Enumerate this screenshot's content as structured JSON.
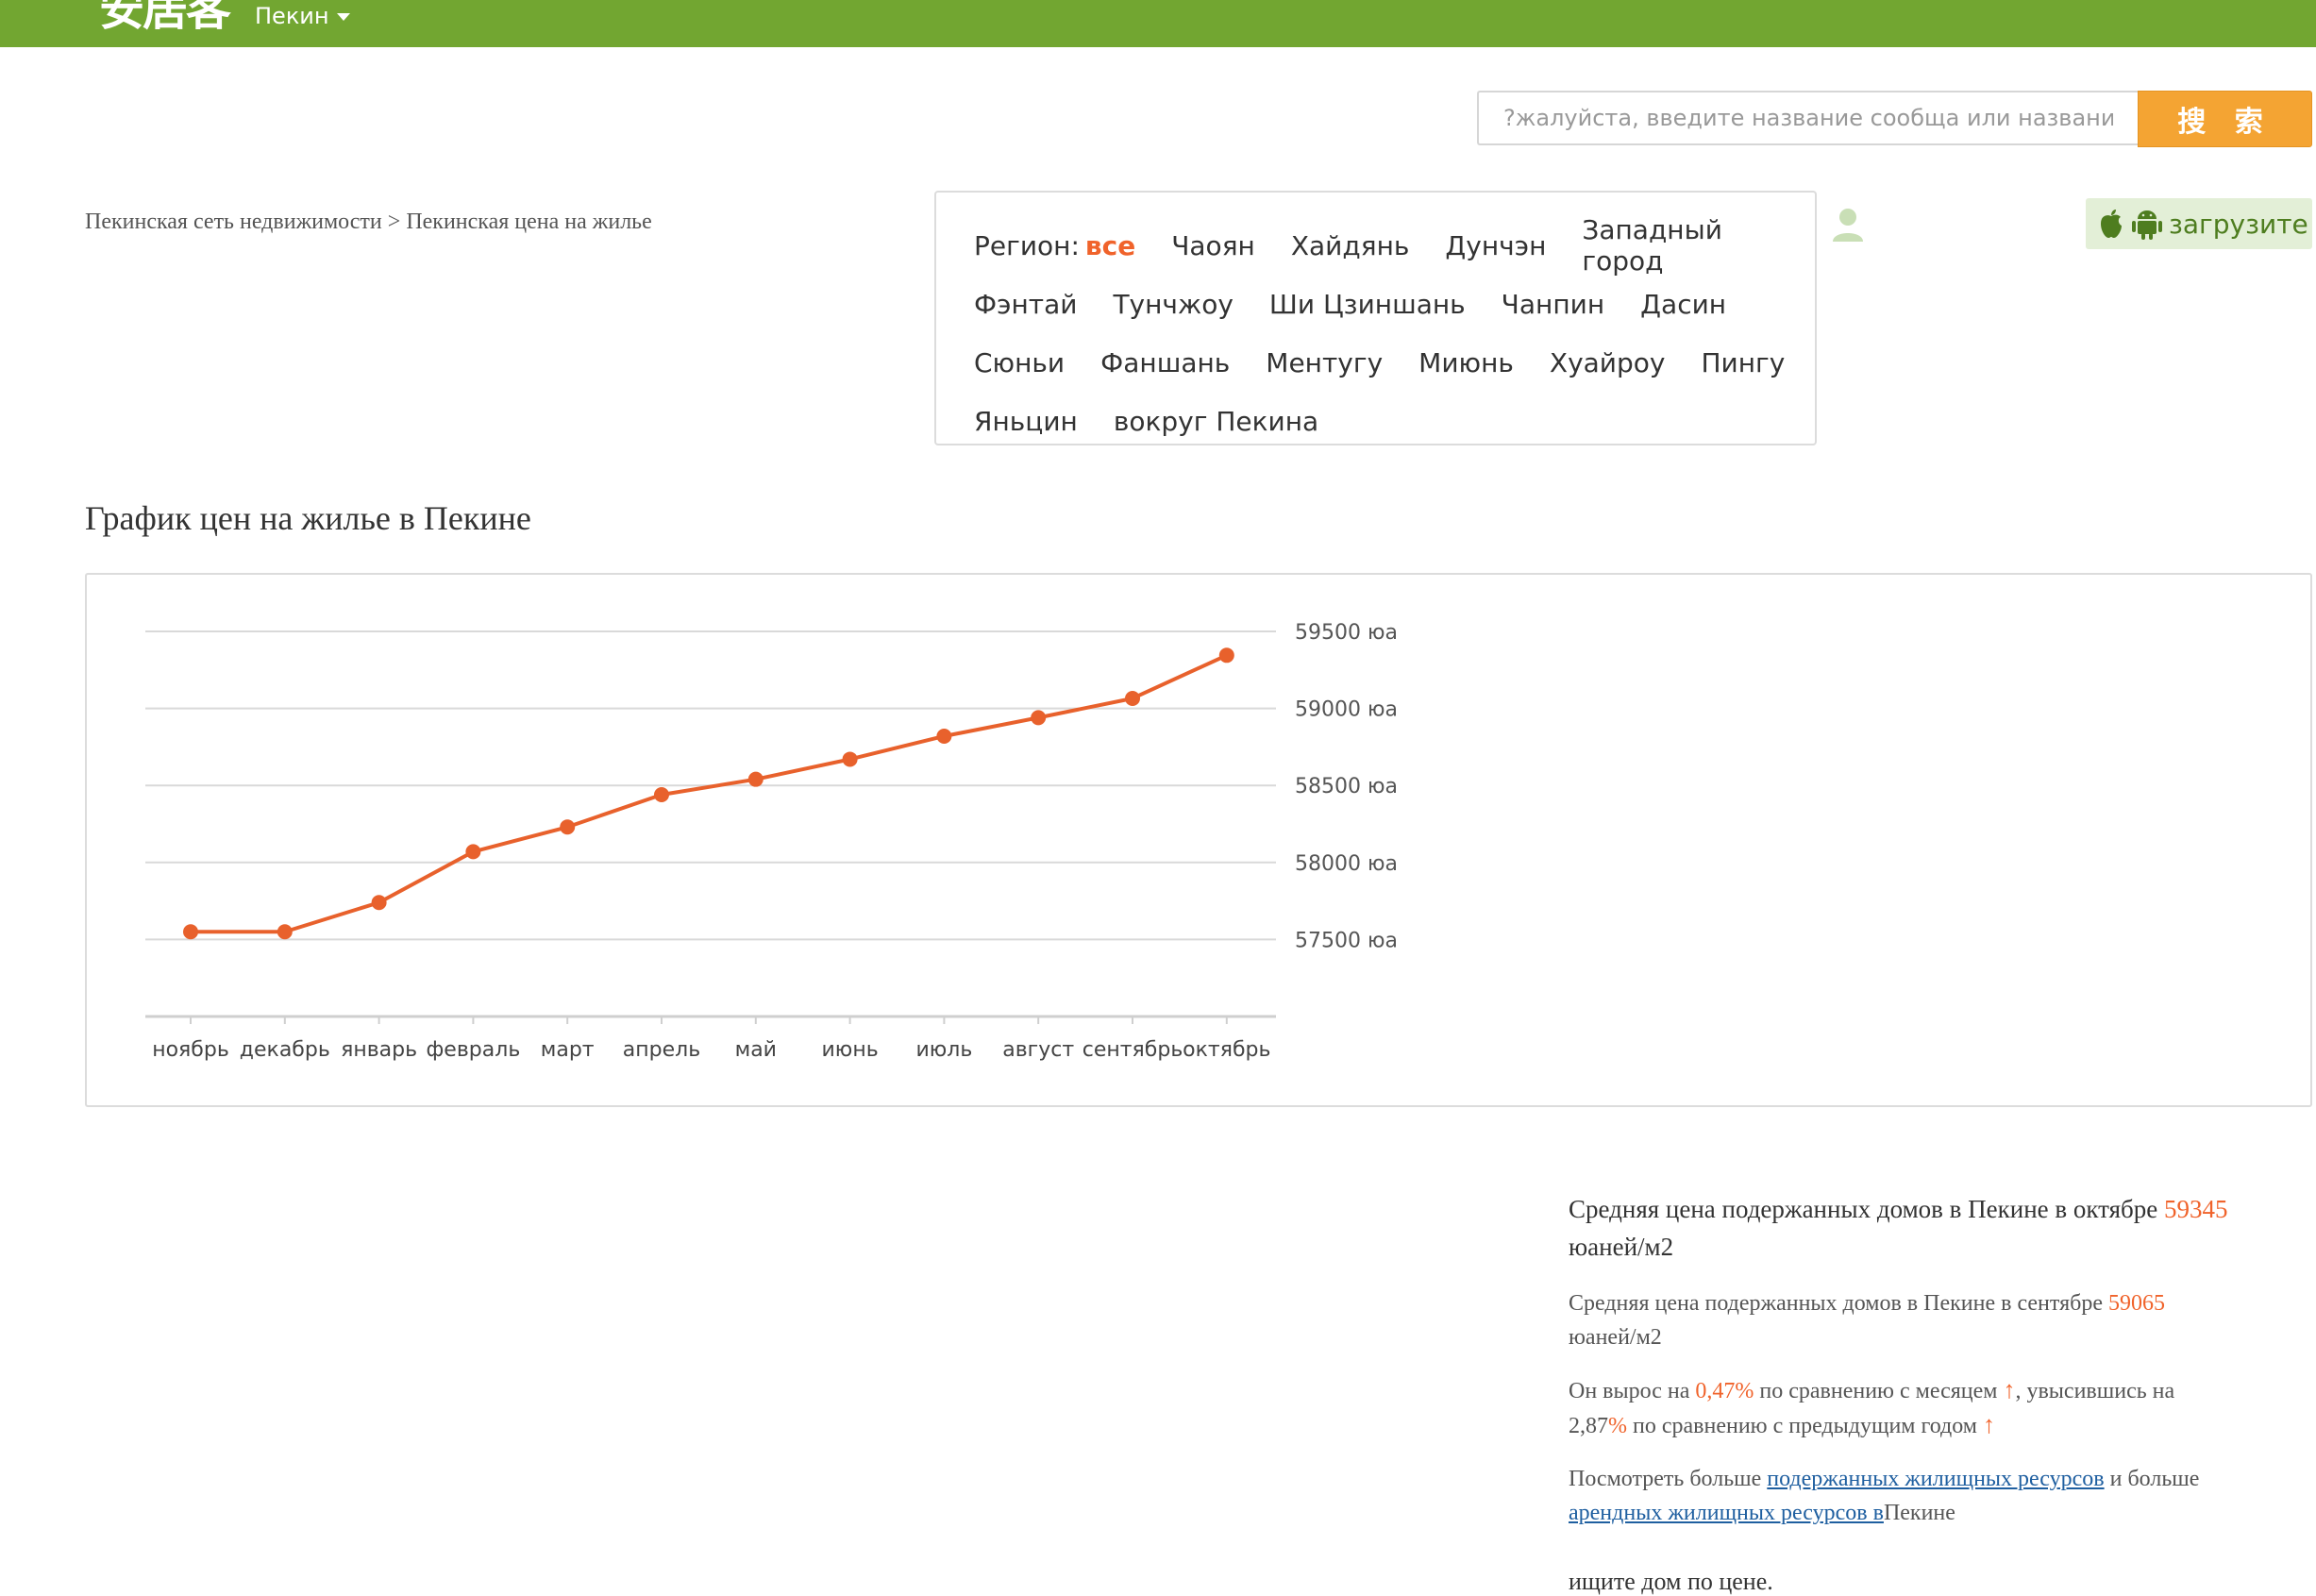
{
  "header": {
    "logo": "安居客",
    "city": "Пекин"
  },
  "search": {
    "placeholder": "?жалуйста, введите название сообща или название дороги",
    "button_label": "搜 索"
  },
  "breadcrumb": {
    "home": "Пекинская сеть недвижимости",
    "separator": ">",
    "current": "Пекинская цена на жилье"
  },
  "region": {
    "label": "Регион:",
    "all": "все",
    "rows": [
      [
        "Чаоян",
        "Хайдянь",
        "Дунчэн",
        "Западный город"
      ],
      [
        "Фэнтай",
        "Тунчжоу",
        "Ши Цзиншань",
        "Чанпин",
        "Дасин"
      ],
      [
        "Сюньи",
        "Фаншань",
        "Ментугу",
        "Миюнь",
        "Хуайроу",
        "Пингу"
      ],
      [
        "Яньцин",
        "вокруг Пекина"
      ]
    ]
  },
  "download": {
    "label": "загрузите"
  },
  "section_title": "График цен на жилье в Пекине",
  "chart_data": {
    "type": "line",
    "categories": [
      "ноябрь",
      "декабрь",
      "январь",
      "февраль",
      "март",
      "апрель",
      "май",
      "июнь",
      "июль",
      "август",
      "сентябрь",
      "октябрь"
    ],
    "values": [
      57550,
      57550,
      57740,
      58070,
      58230,
      58440,
      58540,
      58670,
      58820,
      58940,
      59065,
      59345
    ],
    "ylim": [
      57000,
      59500
    ],
    "yticks": [
      57500,
      58000,
      58500,
      59000,
      59500
    ],
    "ytick_labels": [
      "57500 юа",
      "58000 юа",
      "58500 юа",
      "59000 юа",
      "59500 юа"
    ],
    "y_axis_side": "right",
    "grid": true,
    "color": "#e8612c"
  },
  "info": {
    "p1_text": "Средняя цена подержанных домов в Пекине в октябре",
    "p1_value": "59345",
    "p1_unit": "юаней/м2",
    "p2_text": "Средняя цена подержанных домов в Пекине в сентябре",
    "p2_value": "59065",
    "p2_unit": "юаней/м2",
    "p3_a": "Он вырос на",
    "p3_mom": "0,47%",
    "p3_b": "по сравнению с месяцем",
    "p3_c": ", увысившись на",
    "p3_yoy_num": "2,87",
    "p3_yoy_pct": "%",
    "p3_d": "по сравнению с предыдущим годом",
    "arrow": "↑",
    "p4_a": "Посмотреть больше",
    "p4_link1": "подержанных жилищных ресурсов",
    "p4_b": "и больше",
    "p4_link2": "арендных жилищных ресурсов в",
    "p4_c": "Пекине",
    "p5": "ищите дом по цене."
  }
}
